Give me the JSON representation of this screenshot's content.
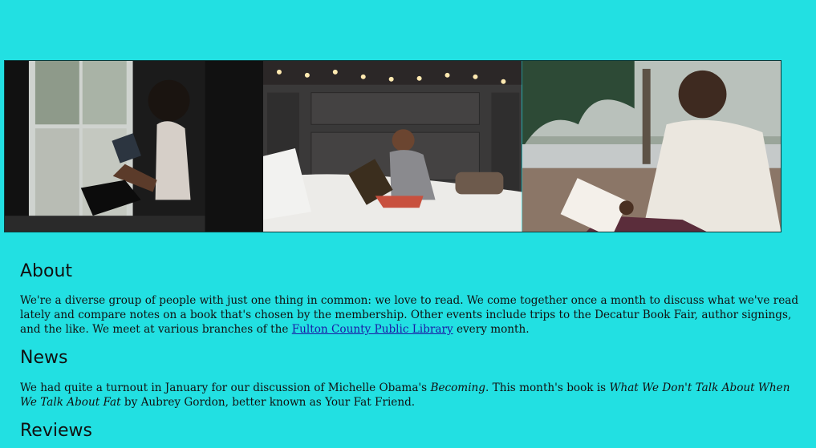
{
  "images": [
    {
      "alt": "woman reading by window"
    },
    {
      "alt": "child reading on bed"
    },
    {
      "alt": "man reading outdoors"
    }
  ],
  "about": {
    "heading": "About",
    "text_before_link": "We're a diverse group of people with just one thing in common: we love to read. We come together once a month to discuss what we've read lately and compare notes on a book that's chosen by the membership. Other events include trips to the Decatur Book Fair, author signings, and the like. We meet at various branches of the ",
    "link_text": "Fulton County Public Library",
    "text_after_link": " every month."
  },
  "news": {
    "heading": "News",
    "text_1": "We had quite a turnout in January for our discussion of Michelle Obama's ",
    "book_1": "Becoming",
    "text_2": ". This month's book is ",
    "book_2": "What We Don't Talk About When We Talk About Fat",
    "text_3": " by Aubrey Gordon, better known as Your Fat Friend."
  },
  "reviews": {
    "heading": "Reviews"
  },
  "colors": {
    "background": "#22e0e2",
    "link": "#1a1aa6"
  }
}
